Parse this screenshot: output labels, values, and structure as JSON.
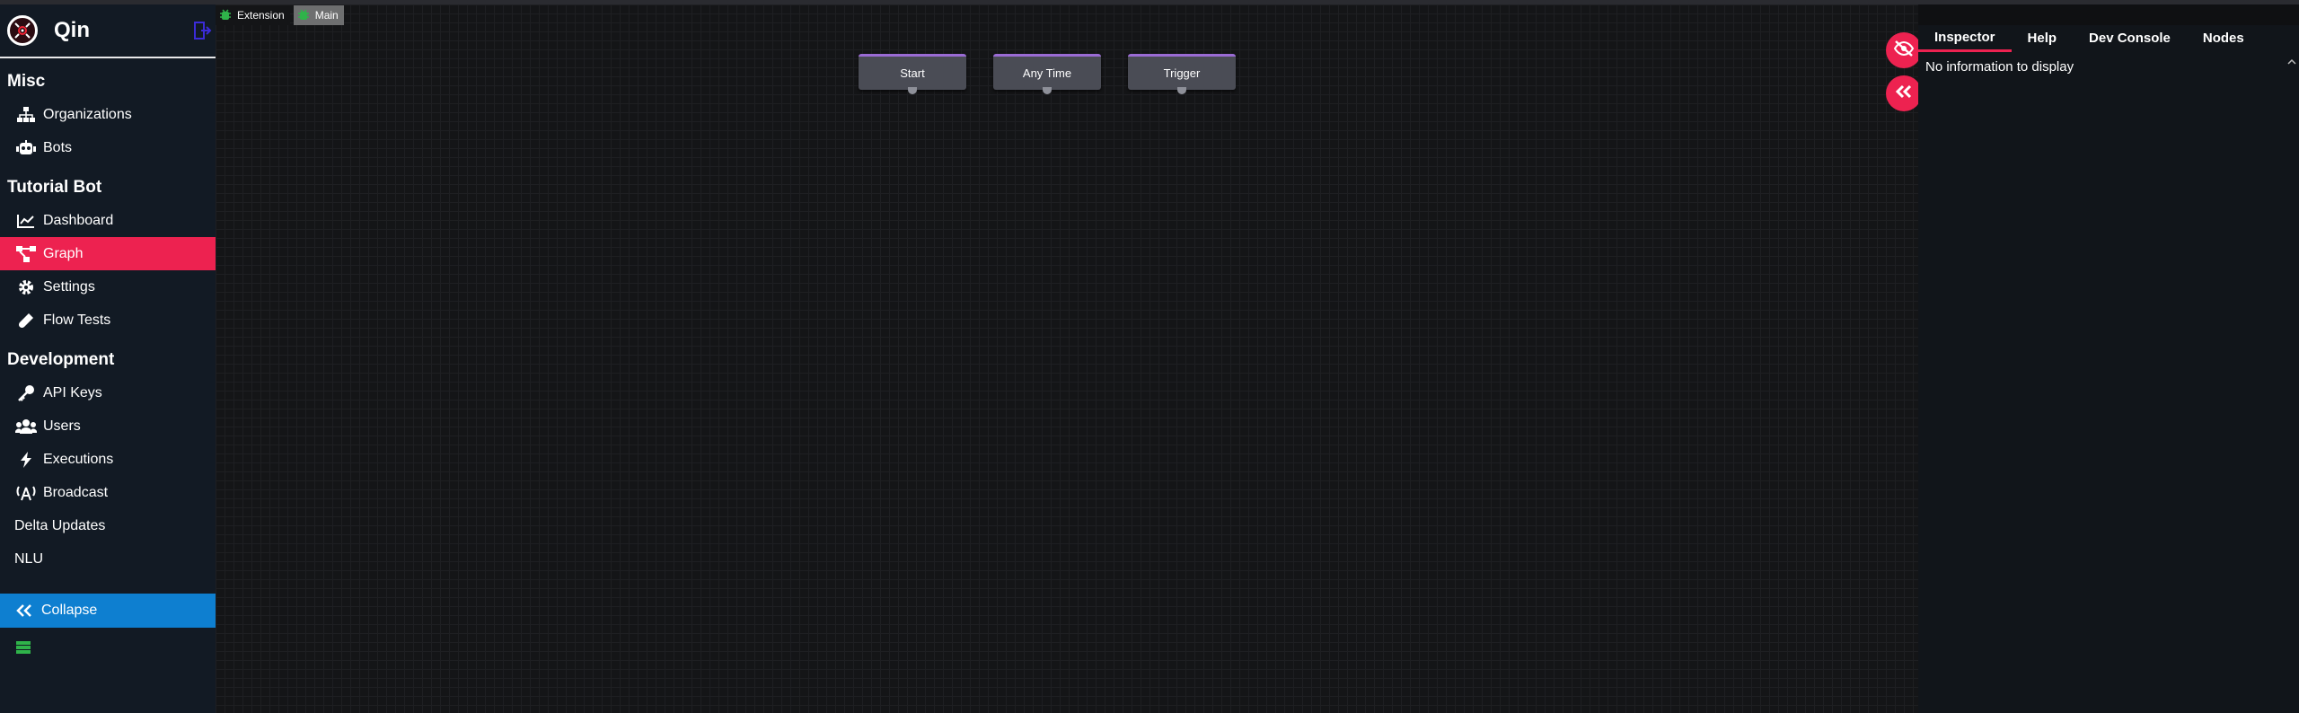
{
  "app": {
    "name": "Qin"
  },
  "sidebar": {
    "sections": [
      {
        "title": "Misc"
      },
      {
        "title": "Tutorial Bot"
      },
      {
        "title": "Development"
      }
    ],
    "misc_items": [
      {
        "label": "Organizations",
        "icon": "sitemap-icon"
      },
      {
        "label": "Bots",
        "icon": "robot-icon"
      }
    ],
    "bot_items": [
      {
        "label": "Dashboard",
        "icon": "chart-line-icon"
      },
      {
        "label": "Graph",
        "icon": "graph-icon",
        "active": true
      },
      {
        "label": "Settings",
        "icon": "gear-icon"
      },
      {
        "label": "Flow Tests",
        "icon": "test-tube-icon"
      }
    ],
    "dev_items": [
      {
        "label": "API Keys",
        "icon": "key-icon"
      },
      {
        "label": "Users",
        "icon": "users-icon"
      },
      {
        "label": "Executions",
        "icon": "bolt-icon"
      },
      {
        "label": "Broadcast",
        "icon": "broadcast-icon"
      },
      {
        "label": "Delta Updates"
      },
      {
        "label": "NLU"
      }
    ],
    "collapse_label": "Collapse"
  },
  "flow_tabs": [
    {
      "label": "Extension"
    },
    {
      "label": "Main",
      "active": true
    }
  ],
  "nodes": [
    {
      "label": "Start"
    },
    {
      "label": "Any Time"
    },
    {
      "label": "Trigger"
    }
  ],
  "panel": {
    "tabs": [
      "Inspector",
      "Help",
      "Dev Console",
      "Nodes"
    ],
    "active_tab": "Inspector",
    "message": "No information to display"
  },
  "colors": {
    "accent": "#ed2250",
    "collapse": "#0e7fd0",
    "sidebar_bg": "#121a24",
    "node_border": "#9a6bd4"
  }
}
